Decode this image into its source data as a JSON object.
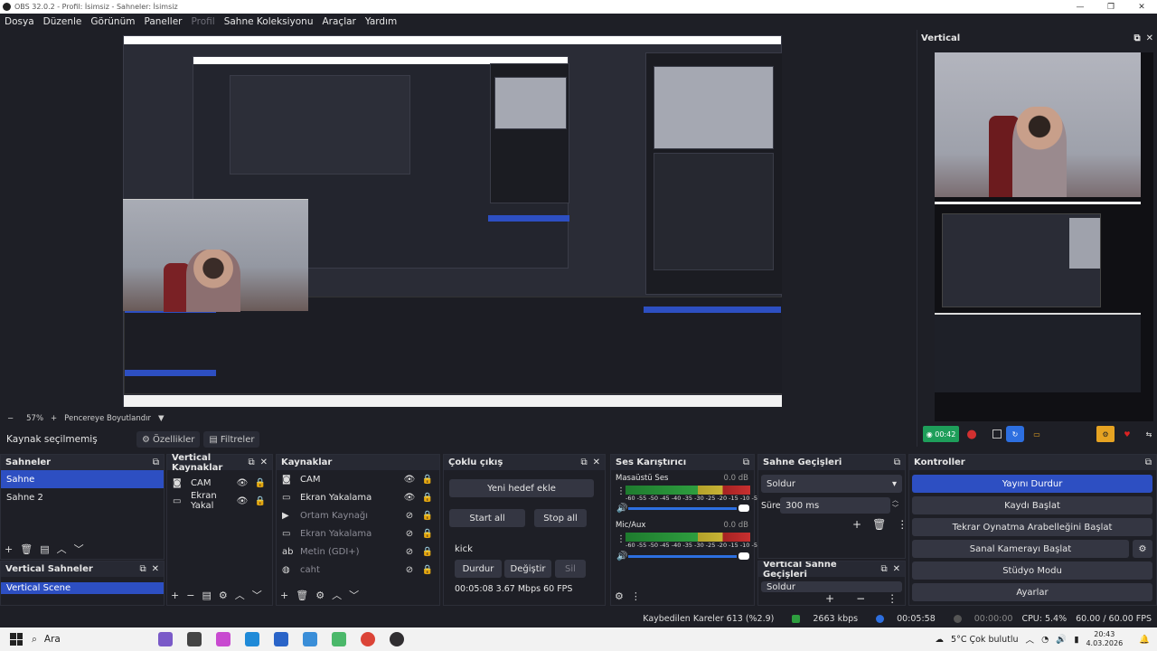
{
  "window": {
    "title": "OBS 32.0.2 - Profil: İsimsiz - Sahneler: İsimsiz",
    "minimize": "—",
    "maximize": "❐",
    "close": "✕"
  },
  "menu": {
    "items": [
      "Dosya",
      "Düzenle",
      "Görünüm",
      "Paneller",
      "Profil",
      "Sahne Koleksiyonu",
      "Araçlar",
      "Yardım"
    ]
  },
  "zoom_bar": {
    "minus": "−",
    "zoom": "57%",
    "plus": "+",
    "fit": "Pencereye Boyutlandır",
    "arrow": "▼"
  },
  "source_bar": {
    "status": "Kaynak seçilmemiş",
    "properties": "Özellikler",
    "filters": "Filtreler"
  },
  "vertical_dock": {
    "title": "Vertical",
    "rec_time": "00:42"
  },
  "scenes": {
    "title": "Sahneler",
    "items": [
      "Sahne",
      "Sahne 2"
    ]
  },
  "vertical_scenes": {
    "title": "Vertical Sahneler",
    "items": [
      "Vertical Scene"
    ]
  },
  "vertical_sources": {
    "title": "Vertical Kaynaklar",
    "items": [
      "CAM",
      "Ekran Yakal"
    ]
  },
  "sources": {
    "title": "Kaynaklar",
    "items": [
      "CAM",
      "Ekran Yakalama",
      "Ortam Kaynağı",
      "Ekran Yakalama",
      "Metin (GDI+)",
      "caht"
    ]
  },
  "multi_output": {
    "title": "Çoklu çıkış",
    "add_target": "Yeni hedef ekle",
    "start_all": "Start all",
    "stop_all": "Stop all",
    "target_name": "kick",
    "stop": "Durdur",
    "change": "Değiştir",
    "delete": "Sil",
    "stats": "00:05:08  3.67 Mbps  60 FPS"
  },
  "mixer": {
    "title": "Ses Karıştırıcı",
    "channels": [
      {
        "name": "Masaüstü Ses",
        "level": "0.0 dB"
      },
      {
        "name": "Mic/Aux",
        "level": "0.0 dB"
      }
    ],
    "scale": "-60 -55 -50 -45 -40 -35 -30 -25 -20 -15 -10 -5 0"
  },
  "transitions": {
    "title": "Sahne Geçişleri",
    "type": "Soldur",
    "duration_label": "Süre",
    "duration_value": "300 ms"
  },
  "vertical_transitions": {
    "title": "Vertical Sahne Geçişleri",
    "type": "Soldur"
  },
  "controls": {
    "title": "Kontroller",
    "stop_stream": "Yayını Durdur",
    "start_record": "Kaydı Başlat",
    "replay_buffer": "Tekrar Oynatma Arabelleğini Başlat",
    "virtual_cam": "Sanal Kamerayı Başlat",
    "studio_mode": "Stüdyo Modu",
    "settings": "Ayarlar"
  },
  "status_bar": {
    "dropped": "Kaybedilen Kareler 613 (%2.9)",
    "bitrate": "2663 kbps",
    "stream_time": "00:05:58",
    "rec_time": "00:00:00",
    "cpu": "CPU: 5.4%",
    "fps": "60.00 / 60.00 FPS"
  },
  "taskbar": {
    "search": "Ara",
    "weather": "5°C  Çok bulutlu",
    "time": "20:43",
    "date": "4.03.2026"
  },
  "colors": {
    "accent": "#2d4fc2",
    "green": "#1e9e5a",
    "background": "#1e1f26"
  }
}
